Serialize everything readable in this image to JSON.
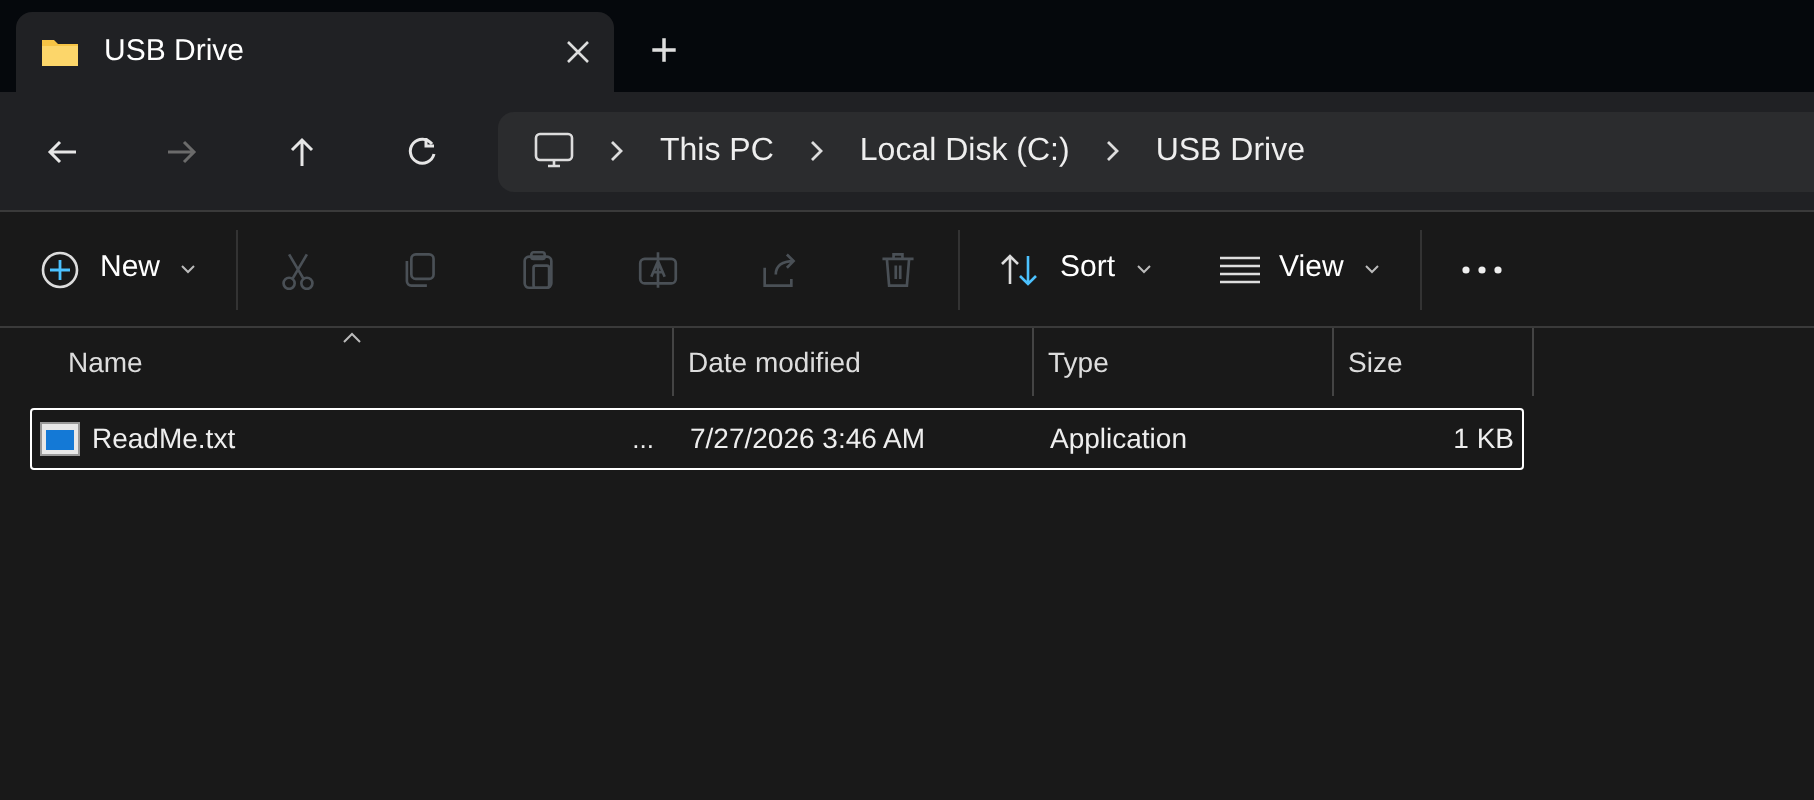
{
  "tabs": [
    {
      "title": "USB Drive",
      "selected": true
    }
  ],
  "new_tab": "+",
  "nav": [
    {
      "kind": "back",
      "disabled": false
    },
    {
      "kind": "forward",
      "disabled": true
    },
    {
      "kind": "up",
      "disabled": false
    },
    {
      "kind": "refresh",
      "disabled": false
    }
  ],
  "breadcrumb": [
    "This PC",
    "Local Disk (C:)",
    "USB Drive"
  ],
  "toolbar": {
    "new": "New",
    "actions": [
      {
        "kind": "cut",
        "disabled": true
      },
      {
        "kind": "copy",
        "disabled": true
      },
      {
        "kind": "paste",
        "disabled": true
      },
      {
        "kind": "rename",
        "disabled": true
      },
      {
        "kind": "share",
        "disabled": true
      },
      {
        "kind": "delete",
        "disabled": true
      }
    ],
    "sort": "Sort",
    "view": "View"
  },
  "columns": [
    {
      "label": "Name",
      "sorted": true
    },
    {
      "label": "Date modified",
      "sorted": false
    },
    {
      "label": "Type",
      "sorted": false
    },
    {
      "label": "Size",
      "sorted": false
    }
  ],
  "rows": [
    {
      "name": "ReadMe.txt",
      "overflow": "...",
      "date": "7/27/2026 3:46 AM",
      "type": "Application",
      "size": "1 KB",
      "selected": true
    }
  ]
}
